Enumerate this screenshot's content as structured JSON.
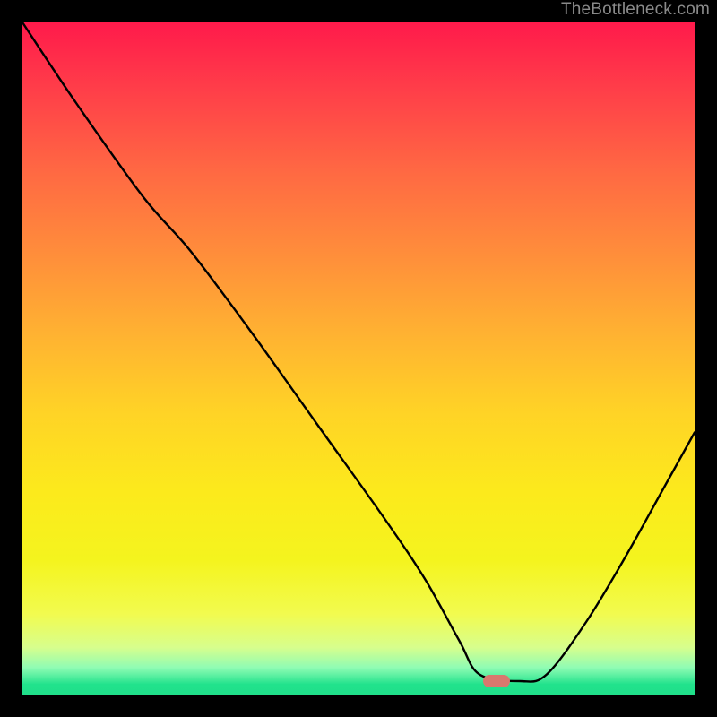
{
  "watermark": "TheBottleneck.com",
  "marker": {
    "x_pct": 70.5,
    "y_pct": 98.0
  },
  "chart_data": {
    "type": "line",
    "title": "",
    "xlabel": "",
    "ylabel": "",
    "xlim": [
      0,
      100
    ],
    "ylim": [
      0,
      100
    ],
    "grid": false,
    "legend": null,
    "series": [
      {
        "name": "bottleneck-curve",
        "x": [
          0,
          8,
          18,
          25,
          34,
          44,
          54,
          60,
          65,
          68,
          74,
          78,
          84,
          90,
          95,
          100
        ],
        "y": [
          100,
          88,
          74,
          66,
          54,
          40,
          26,
          17,
          8,
          3,
          2,
          3,
          11,
          21,
          30,
          39
        ]
      }
    ],
    "marker_point": {
      "x": 70.5,
      "y": 2
    },
    "gradient_stops": [
      {
        "pct": 0,
        "color": "#ff1a4b"
      },
      {
        "pct": 10,
        "color": "#ff3e49"
      },
      {
        "pct": 22,
        "color": "#ff6843"
      },
      {
        "pct": 34,
        "color": "#ff8c3b"
      },
      {
        "pct": 46,
        "color": "#ffb132"
      },
      {
        "pct": 58,
        "color": "#ffd326"
      },
      {
        "pct": 70,
        "color": "#fcea1c"
      },
      {
        "pct": 80,
        "color": "#f4f41e"
      },
      {
        "pct": 88,
        "color": "#f2fb4f"
      },
      {
        "pct": 93,
        "color": "#d7fe8d"
      },
      {
        "pct": 96,
        "color": "#8ffcb4"
      },
      {
        "pct": 98.5,
        "color": "#21e28c"
      },
      {
        "pct": 100,
        "color": "#20df8a"
      }
    ]
  }
}
